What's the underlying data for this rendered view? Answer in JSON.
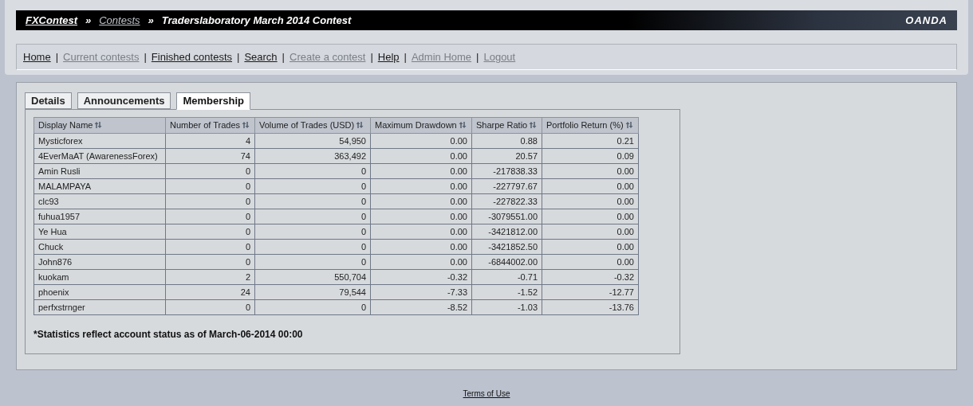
{
  "breadcrumb": [
    {
      "label": "FXContest",
      "visited": false
    },
    {
      "label": "Contests",
      "visited": true
    },
    {
      "label": "Traderslaboratory March 2014 Contest",
      "visited": false
    }
  ],
  "breadcrumb_separator": "»",
  "brand": "OANDA",
  "nav": [
    {
      "label": "Home",
      "visited": false
    },
    {
      "label": "Current contests",
      "visited": true
    },
    {
      "label": "Finished contests",
      "visited": false
    },
    {
      "label": "Search",
      "visited": false
    },
    {
      "label": "Create a contest",
      "visited": true
    },
    {
      "label": "Help",
      "visited": false
    },
    {
      "label": "Admin Home",
      "visited": true
    },
    {
      "label": "Logout",
      "visited": true
    }
  ],
  "nav_separator": "|",
  "tabs": [
    {
      "label": "Details",
      "selected": false
    },
    {
      "label": "Announcements",
      "selected": false
    },
    {
      "label": "Membership",
      "selected": true
    }
  ],
  "table": {
    "columns": [
      "Display Name",
      "Number of Trades",
      "Volume of Trades (USD)",
      "Maximum Drawdown",
      "Sharpe Ratio",
      "Portfolio Return (%)"
    ],
    "rows": [
      [
        "Mysticforex",
        "4",
        "54,950",
        "0.00",
        "0.88",
        "0.21"
      ],
      [
        "4EverMaAT (AwarenessForex)",
        "74",
        "363,492",
        "0.00",
        "20.57",
        "0.09"
      ],
      [
        "Amin Rusli",
        "0",
        "0",
        "0.00",
        "-217838.33",
        "0.00"
      ],
      [
        "MALAMPAYA",
        "0",
        "0",
        "0.00",
        "-227797.67",
        "0.00"
      ],
      [
        "clc93",
        "0",
        "0",
        "0.00",
        "-227822.33",
        "0.00"
      ],
      [
        "fuhua1957",
        "0",
        "0",
        "0.00",
        "-3079551.00",
        "0.00"
      ],
      [
        "Ye Hua",
        "0",
        "0",
        "0.00",
        "-3421812.00",
        "0.00"
      ],
      [
        "Chuck",
        "0",
        "0",
        "0.00",
        "-3421852.50",
        "0.00"
      ],
      [
        "John876",
        "0",
        "0",
        "0.00",
        "-6844002.00",
        "0.00"
      ],
      [
        "kuokam",
        "2",
        "550,704",
        "-0.32",
        "-0.71",
        "-0.32"
      ],
      [
        "phoenix",
        "24",
        "79,544",
        "-7.33",
        "-1.52",
        "-12.77"
      ],
      [
        "perfxstrnger",
        "0",
        "0",
        "-8.52",
        "-1.03",
        "-13.76"
      ]
    ]
  },
  "note": "*Statistics reflect account status as of March-06-2014 00:00",
  "footer_link": "Terms of Use"
}
